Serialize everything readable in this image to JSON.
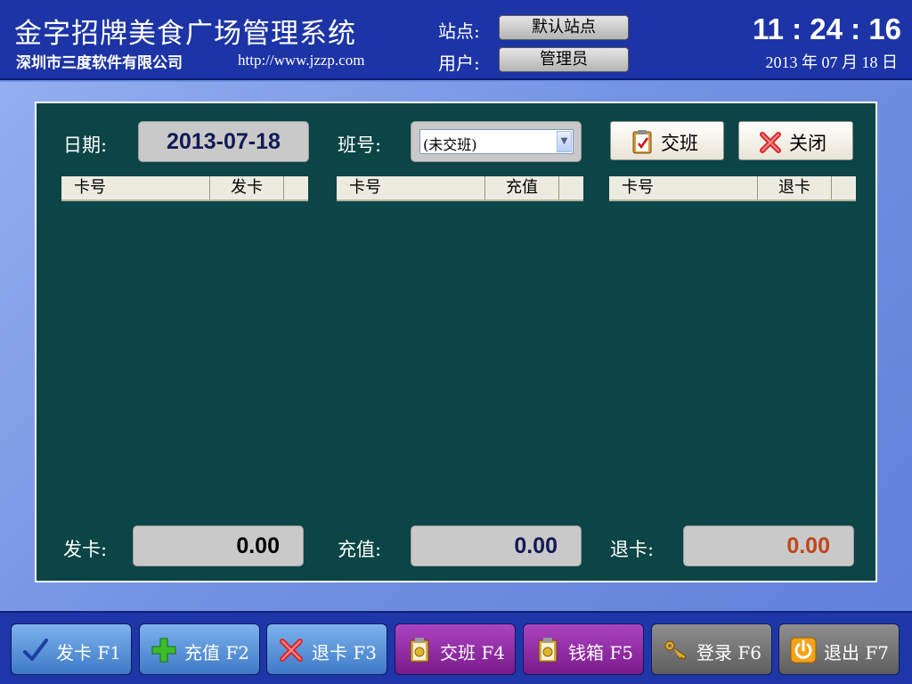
{
  "header": {
    "app_title": "金字招牌美食广场管理系统",
    "company": "深圳市三度软件有限公司",
    "url": "http://www.jzzp.com",
    "site_label": "站点:",
    "site_value": "默认站点",
    "user_label": "用户:",
    "user_value": "管理员",
    "clock": "11 : 24 : 16",
    "date": "2013 年 07 月 18 日"
  },
  "form": {
    "date_label": "日期:",
    "date_value": "2013-07-18",
    "shift_label": "班号:",
    "shift_value": "(未交班)",
    "handover_button": "交班",
    "close_button": "关闭"
  },
  "tables": [
    {
      "col1": "卡号",
      "col2": "发卡"
    },
    {
      "col1": "卡号",
      "col2": "充值"
    },
    {
      "col1": "卡号",
      "col2": "退卡"
    }
  ],
  "totals": {
    "issue_label": "发卡:",
    "issue_value": "0.00",
    "recharge_label": "充值:",
    "recharge_value": "0.00",
    "refund_label": "退卡:",
    "refund_value": "0.00"
  },
  "colors": {
    "panel_bg": "#0b4545",
    "header_bg": "#1d34a6",
    "issue_value": "#000000",
    "recharge_value": "#101a55",
    "refund_value": "#c0461c"
  },
  "toolbar": [
    {
      "label": "发卡 F1",
      "icon": "checkmark-icon"
    },
    {
      "label": "充值 F2",
      "icon": "plus-icon"
    },
    {
      "label": "退卡 F3",
      "icon": "close-x-icon"
    },
    {
      "label": "交班 F4",
      "icon": "clipboard-icon"
    },
    {
      "label": "钱箱 F5",
      "icon": "clipboard-icon"
    },
    {
      "label": "登录 F6",
      "icon": "keys-icon"
    },
    {
      "label": "退出 F7",
      "icon": "power-icon"
    }
  ]
}
